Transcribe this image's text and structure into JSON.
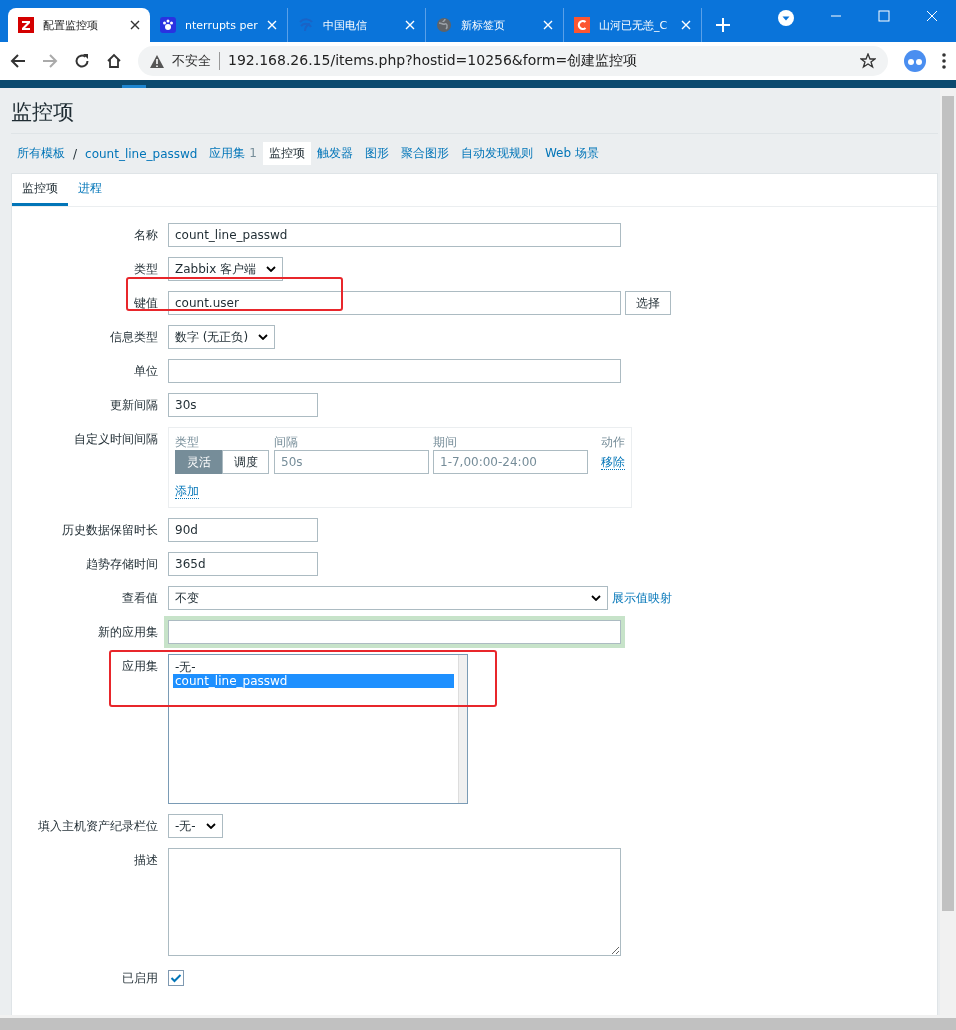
{
  "browser": {
    "tabs": [
      {
        "title": "配置监控项",
        "selected": true
      },
      {
        "title": "nterrupts per",
        "selected": false
      },
      {
        "title": "中国电信",
        "selected": false
      },
      {
        "title": "新标签页",
        "selected": false
      },
      {
        "title": "山河已无恙_C",
        "selected": false
      }
    ],
    "security_label": "不安全",
    "url": "192.168.26.15/items.php?hostid=10256&form=创建监控项"
  },
  "page": {
    "title": "监控项",
    "breadcrumb": [
      {
        "label": "所有模板"
      },
      {
        "label": "count_line_passwd"
      }
    ],
    "breadcrumb_separator": "/",
    "nav": [
      {
        "label": "应用集",
        "count": "1",
        "selected": false
      },
      {
        "label": "监控项",
        "selected": true
      },
      {
        "label": "触发器",
        "selected": false
      },
      {
        "label": "图形",
        "selected": false
      },
      {
        "label": "聚合图形",
        "selected": false
      },
      {
        "label": "自动发现规则",
        "selected": false
      },
      {
        "label": "Web 场景",
        "selected": false
      }
    ],
    "tabs": [
      {
        "label": "监控项",
        "selected": true
      },
      {
        "label": "进程",
        "selected": false
      }
    ],
    "form": [
      {
        "label": "名称",
        "kind": "text",
        "value": "count_line_passwd"
      },
      {
        "label": "类型",
        "kind": "select",
        "value": "Zabbix 客户端"
      },
      {
        "label": "键值",
        "kind": "key",
        "value": "count.user",
        "button": "选择",
        "highlighted": true
      },
      {
        "label": "信息类型",
        "kind": "select",
        "value": "数字 (无正负)"
      },
      {
        "label": "单位",
        "kind": "text"
      },
      {
        "label": "更新间隔",
        "kind": "short",
        "value": "30s"
      },
      {
        "label": "自定义时间间隔",
        "kind": "intervals",
        "columns": [
          "类型",
          "间隔",
          "期间",
          "动作"
        ],
        "rows": [
          {
            "types": [
              {
                "label": "灵活",
                "selected": true
              },
              {
                "label": "调度",
                "selected": false
              }
            ],
            "interval": "50s",
            "period": "1-7,00:00-24:00",
            "action": "移除"
          }
        ],
        "add": "添加"
      },
      {
        "label": "历史数据保留时长",
        "kind": "short",
        "value": "90d"
      },
      {
        "label": "趋势存储时间",
        "kind": "short",
        "value": "365d"
      },
      {
        "label": "查看值",
        "kind": "wideselect",
        "value": "不变",
        "link": "展示值映射"
      },
      {
        "label": "新的应用集",
        "kind": "text",
        "focused": true
      },
      {
        "label": "应用集",
        "kind": "listbox",
        "options": [
          {
            "label": "-无-",
            "selected": false
          },
          {
            "label": "count_line_passwd",
            "selected": true
          }
        ],
        "highlighted": true
      },
      {
        "label": "填入主机资产纪录栏位",
        "kind": "select",
        "value": "-无-"
      },
      {
        "label": "描述",
        "kind": "textarea"
      },
      {
        "label": "已启用",
        "kind": "checkbox",
        "checked": true
      }
    ]
  }
}
